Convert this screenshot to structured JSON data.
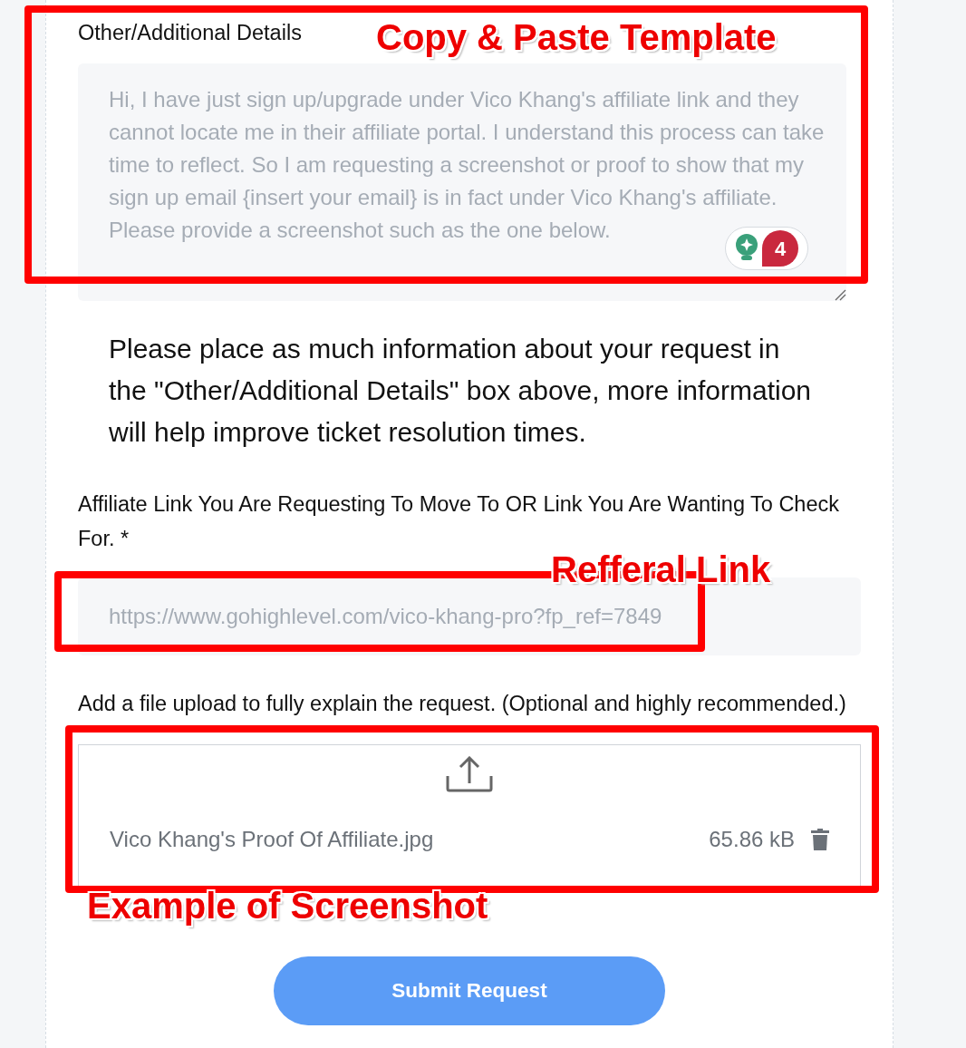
{
  "form": {
    "details": {
      "label": "Other/Additional Details",
      "placeholder": "Hi, I have just sign up/upgrade under Vico Khang's affiliate link and they cannot locate me in their affiliate portal. I understand this process can take time to reflect. So I am requesting a screenshot or proof to show that my sign up email {insert your email} is in fact under Vico Khang's affiliate. Please provide a screenshot such as the one below.",
      "grammar_badge": {
        "count": "4"
      }
    },
    "note": "Please place as much information about your request in the \"Other/Additional Details\" box above, more information will help improve ticket resolution times.",
    "link_field": {
      "label": "Affiliate Link You Are Requesting To Move To OR Link You Are Wanting To Check For. *",
      "placeholder": "https://www.gohighlevel.com/vico-khang-pro?fp_ref=7849"
    },
    "upload": {
      "label": "Add a file upload to fully explain the request. (Optional and highly recommended.)",
      "file_name": "Vico Khang's Proof Of Affiliate.jpg",
      "file_size": "65.86 kB"
    },
    "submit_button": "Submit Request"
  },
  "annotations": [
    {
      "label": "Copy & Paste Template"
    },
    {
      "label": "Refferal Link"
    },
    {
      "label": "Example of Screenshot"
    }
  ]
}
